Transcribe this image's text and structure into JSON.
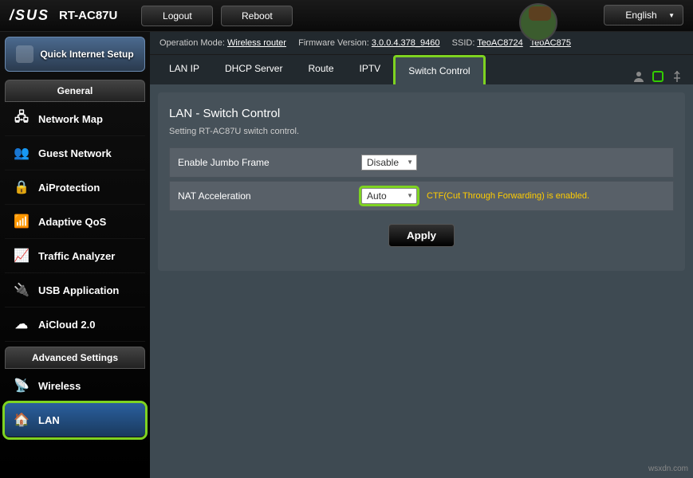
{
  "topbar": {
    "brand": "/SUS",
    "model": "RT-AC87U",
    "logout": "Logout",
    "reboot": "Reboot",
    "language": "English"
  },
  "status": {
    "op_mode_label": "Operation Mode:",
    "op_mode_value": "Wireless router",
    "fw_label": "Firmware Version:",
    "fw_value": "3.0.0.4.378_9460",
    "ssid_label": "SSID:",
    "ssid1": "TeoAC8724",
    "ssid2": "TeoAC875"
  },
  "sidebar": {
    "qis": "Quick Internet Setup",
    "general_header": "General",
    "general": [
      {
        "label": "Network Map",
        "icon": "🖧"
      },
      {
        "label": "Guest Network",
        "icon": "👥"
      },
      {
        "label": "AiProtection",
        "icon": "🔒"
      },
      {
        "label": "Adaptive QoS",
        "icon": "📶"
      },
      {
        "label": "Traffic Analyzer",
        "icon": "📈"
      },
      {
        "label": "USB Application",
        "icon": "🔌"
      },
      {
        "label": "AiCloud 2.0",
        "icon": "☁"
      }
    ],
    "advanced_header": "Advanced Settings",
    "advanced": [
      {
        "label": "Wireless",
        "icon": "📡"
      },
      {
        "label": "LAN",
        "icon": "🏠"
      }
    ]
  },
  "tabs": [
    "LAN IP",
    "DHCP Server",
    "Route",
    "IPTV",
    "Switch Control"
  ],
  "panel": {
    "title": "LAN - Switch Control",
    "desc": "Setting RT-AC87U switch control.",
    "rows": [
      {
        "label": "Enable Jumbo Frame",
        "value": "Disable",
        "note": "",
        "hl": false
      },
      {
        "label": "NAT Acceleration",
        "value": "Auto",
        "note": "CTF(Cut Through Forwarding) is enabled.",
        "hl": true
      }
    ],
    "apply": "Apply"
  },
  "watermark": "wsxdn.com"
}
